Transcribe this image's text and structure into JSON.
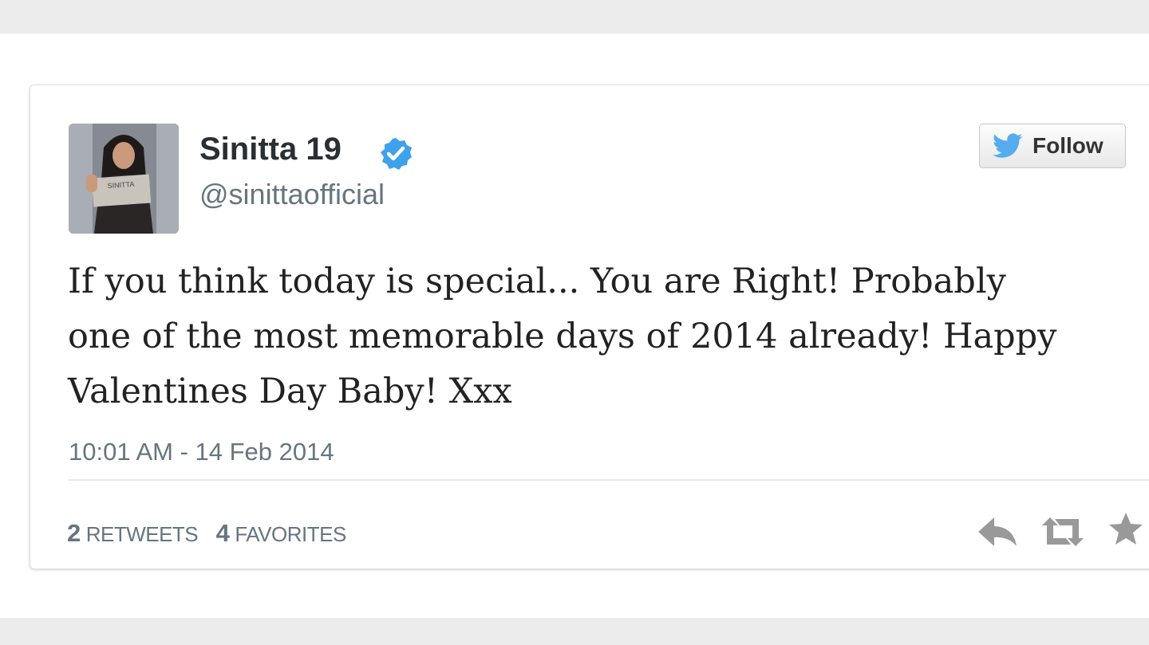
{
  "tweet": {
    "user": {
      "name": "Sinitta 19",
      "handle": "@sinittaofficial",
      "avatar_sign_text": "SINITTA"
    },
    "follow_button": {
      "label": "Follow",
      "icon": "twitter-bird-icon"
    },
    "text_lines": [
      "If you think today is special... You are Right! Probably",
      "one of the most memorable days of 2014 already! Happy",
      "Valentines Day Baby! Xxx"
    ],
    "timestamp": "10:01 AM - 14 Feb 2014",
    "stats": {
      "retweets_count": "2",
      "retweets_label": "RETWEETS",
      "favorites_count": "4",
      "favorites_label": "FAVORITES"
    },
    "actions": [
      "reply-icon",
      "retweet-icon",
      "favorite-star-icon"
    ]
  },
  "colors": {
    "verified_badge": "#3ea1ec",
    "twitter_blue": "#55acee",
    "text_primary": "#292f33",
    "text_secondary": "#66757f",
    "action_icon": "#999999"
  }
}
